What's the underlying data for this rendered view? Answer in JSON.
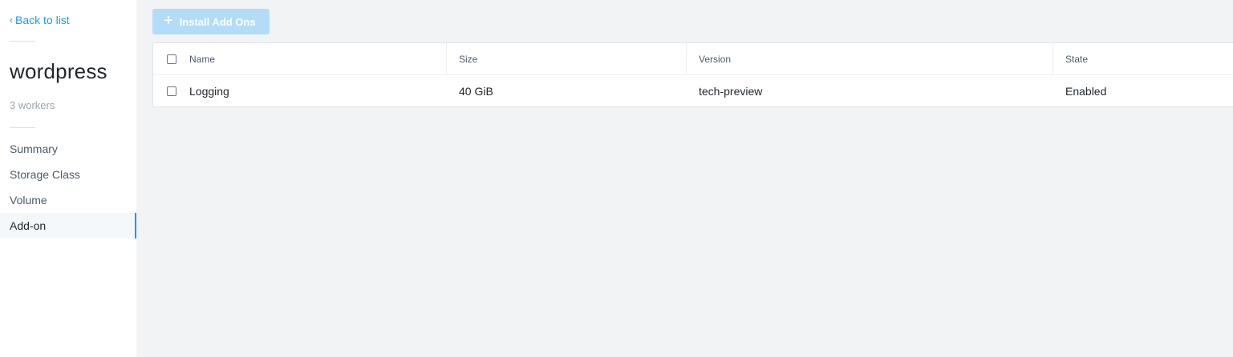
{
  "sidebar": {
    "back_label": "Back to list",
    "title": "wordpress",
    "subtitle": "3 workers",
    "nav": [
      {
        "label": "Summary"
      },
      {
        "label": "Storage Class"
      },
      {
        "label": "Volume"
      },
      {
        "label": "Add-on"
      }
    ],
    "active_item": "Add-on"
  },
  "toolbar": {
    "install_label": "Install Add Ons",
    "install_icon": "plus-icon",
    "install_disabled": true
  },
  "table": {
    "columns": [
      "Name",
      "Size",
      "Version",
      "State"
    ],
    "rows": [
      {
        "name": "Logging",
        "size": "40 GiB",
        "version": "tech-preview",
        "state": "Enabled"
      }
    ]
  },
  "colors": {
    "accent": "#1b9aee",
    "disabled_button": "#b3dcf8",
    "background": "#f2f3f5"
  }
}
